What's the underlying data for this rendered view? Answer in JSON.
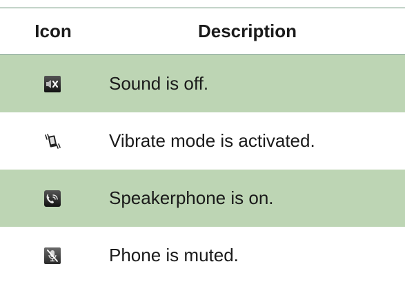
{
  "table": {
    "headers": {
      "icon": "Icon",
      "description": "Description"
    },
    "rows": [
      {
        "icon": "sound-off-icon",
        "description": "Sound is off.",
        "shaded": true
      },
      {
        "icon": "vibrate-icon",
        "description": "Vibrate mode is activated.",
        "shaded": false
      },
      {
        "icon": "speakerphone-icon",
        "description": "Speakerphone is on.",
        "shaded": true
      },
      {
        "icon": "mute-mic-icon",
        "description": "Phone is muted.",
        "shaded": false
      }
    ]
  },
  "colors": {
    "shaded_row": "#bdd5b4",
    "rule": "#5e8a6c"
  }
}
